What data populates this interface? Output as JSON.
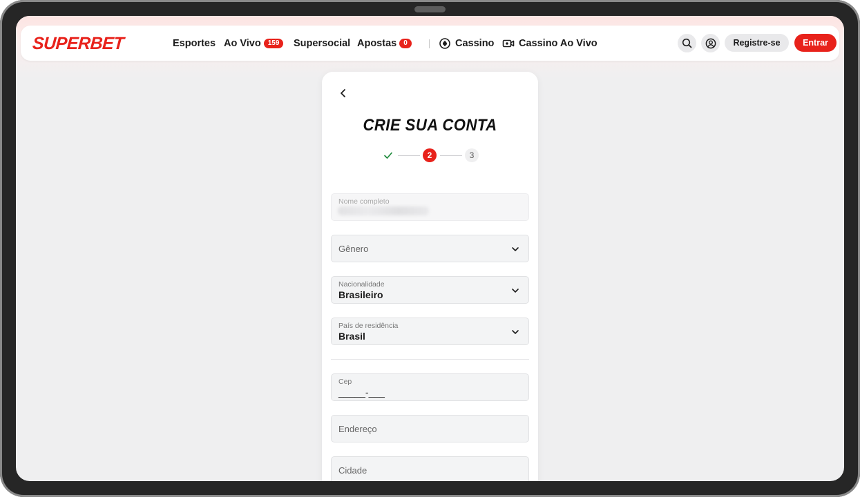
{
  "brand": {
    "logo_text": "SUPERBET",
    "accent": "#e8221b"
  },
  "nav": {
    "items": [
      {
        "label": "Esportes"
      },
      {
        "label": "Ao Vivo",
        "badge": "159"
      },
      {
        "label": "Supersocial"
      },
      {
        "label": "Apostas",
        "badge": "0"
      }
    ],
    "casino_label": "Cassino",
    "live_casino_label": "Cassino Ao Vivo",
    "search_icon": "search-icon",
    "account_icon": "user-circle-icon",
    "register_label": "Registre-se",
    "login_label": "Entrar"
  },
  "form": {
    "title": "CRIE SUA CONTA",
    "steps": {
      "active": "2",
      "pending": "3"
    },
    "fields": {
      "full_name": {
        "label": "Nome completo"
      },
      "gender": {
        "placeholder": "Gênero"
      },
      "nationality": {
        "label": "Nacionalidade",
        "value": "Brasileiro"
      },
      "residence": {
        "label": "País de residência",
        "value": "Brasil"
      },
      "cep": {
        "label": "Cep",
        "value": "_____-___"
      },
      "address": {
        "placeholder": "Endereço"
      },
      "city": {
        "placeholder": "Cidade"
      }
    }
  }
}
